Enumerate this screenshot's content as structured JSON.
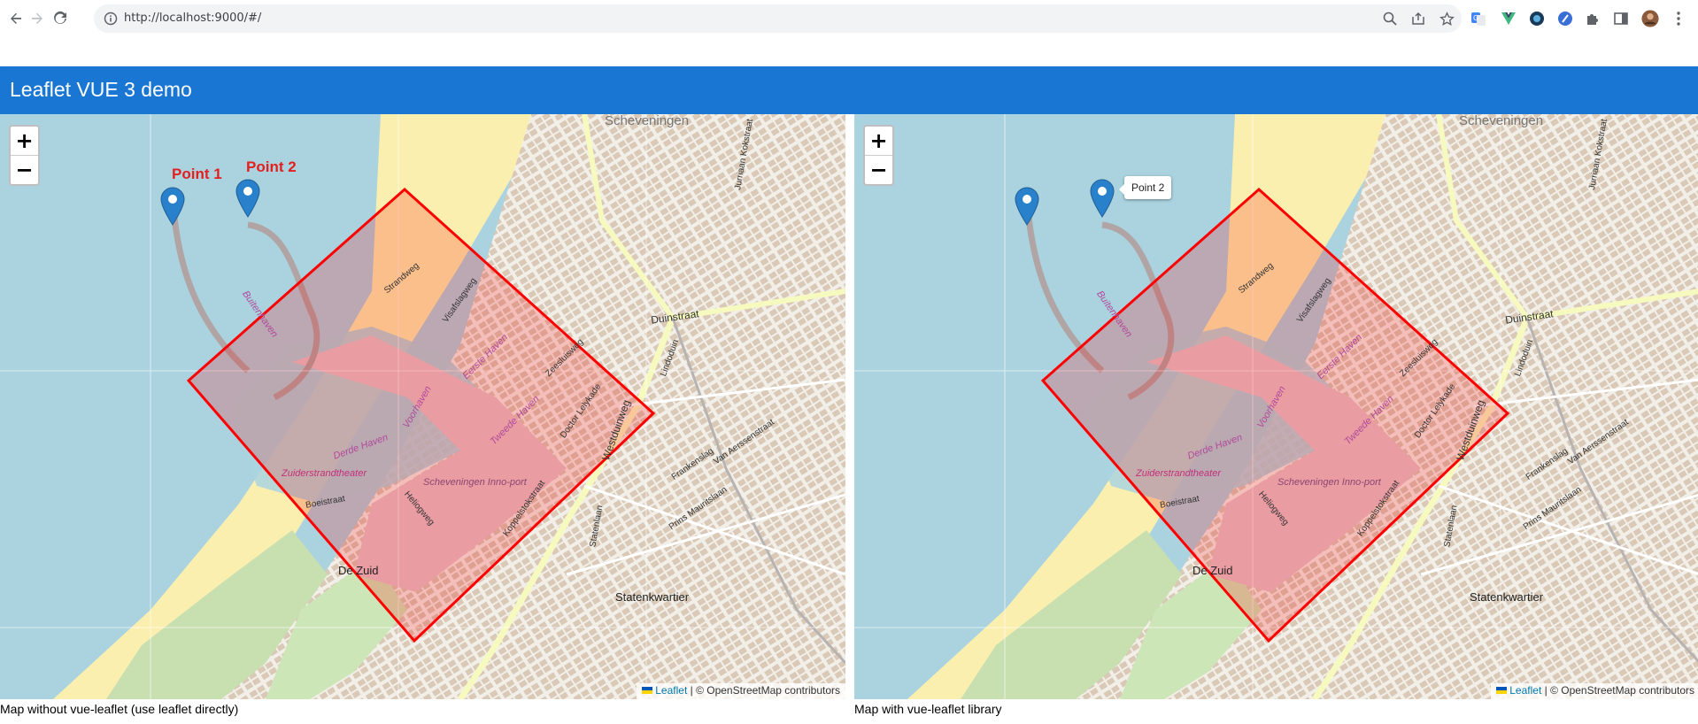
{
  "browser": {
    "url": "http://localhost:9000/#/",
    "icons": [
      "back-icon",
      "forward-icon",
      "reload-icon",
      "info-icon",
      "zoom-icon",
      "share-icon",
      "star-icon",
      "translate-icon",
      "vue-devtools-icon",
      "extension-icon",
      "extension-icon-2",
      "puzzle-icon",
      "sidepanel-icon",
      "profile-avatar",
      "menu-icon"
    ]
  },
  "app": {
    "title": "Leaflet VUE 3 demo"
  },
  "maps": [
    {
      "caption": "Map without vue-leaflet (use leaflet directly)",
      "labels": [
        "Point 1",
        "Point 2"
      ],
      "tooltip": "",
      "zoom_in": "+",
      "zoom_out": "−",
      "attribution_link": "Leaflet",
      "attribution_text": "| © OpenStreetMap contributors"
    },
    {
      "caption": "Map with vue-leaflet library",
      "labels": [],
      "tooltip": "Point 2",
      "zoom_in": "+",
      "zoom_out": "−",
      "attribution_link": "Leaflet",
      "attribution_text": "| © OpenStreetMap contributors"
    }
  ],
  "map_text": {
    "places": [
      "Scheveningen",
      "De Zuid",
      "Statenkwartier",
      "Zuiderstrandtheater",
      "Scheveningen Inno-port"
    ],
    "streets": [
      "Duinstraat",
      "Westduinweg",
      "Strandweg",
      "Zeesluisweg",
      "Doctor Lelykade",
      "Statenlaan",
      "Jurriaan Kokstraat",
      "Frankenslag",
      "Prins Mauritslaan",
      "Visafslagweg",
      "Boeistraat",
      "Heliogweg",
      "Van Aerssenstraat",
      "Lindoduin",
      "Koppelstokstraat"
    ],
    "harbors": [
      "Eerste Haven",
      "Tweede Haven",
      "Derde Haven",
      "Buitenhaven",
      "Voorhaven"
    ]
  },
  "colors": {
    "appbar": "#1976d2",
    "polygon_stroke": "#ff0000",
    "polygon_fill": "#ff0000",
    "sea": "#aad3df",
    "marker": "#2a81cb",
    "label": "#e32020"
  }
}
